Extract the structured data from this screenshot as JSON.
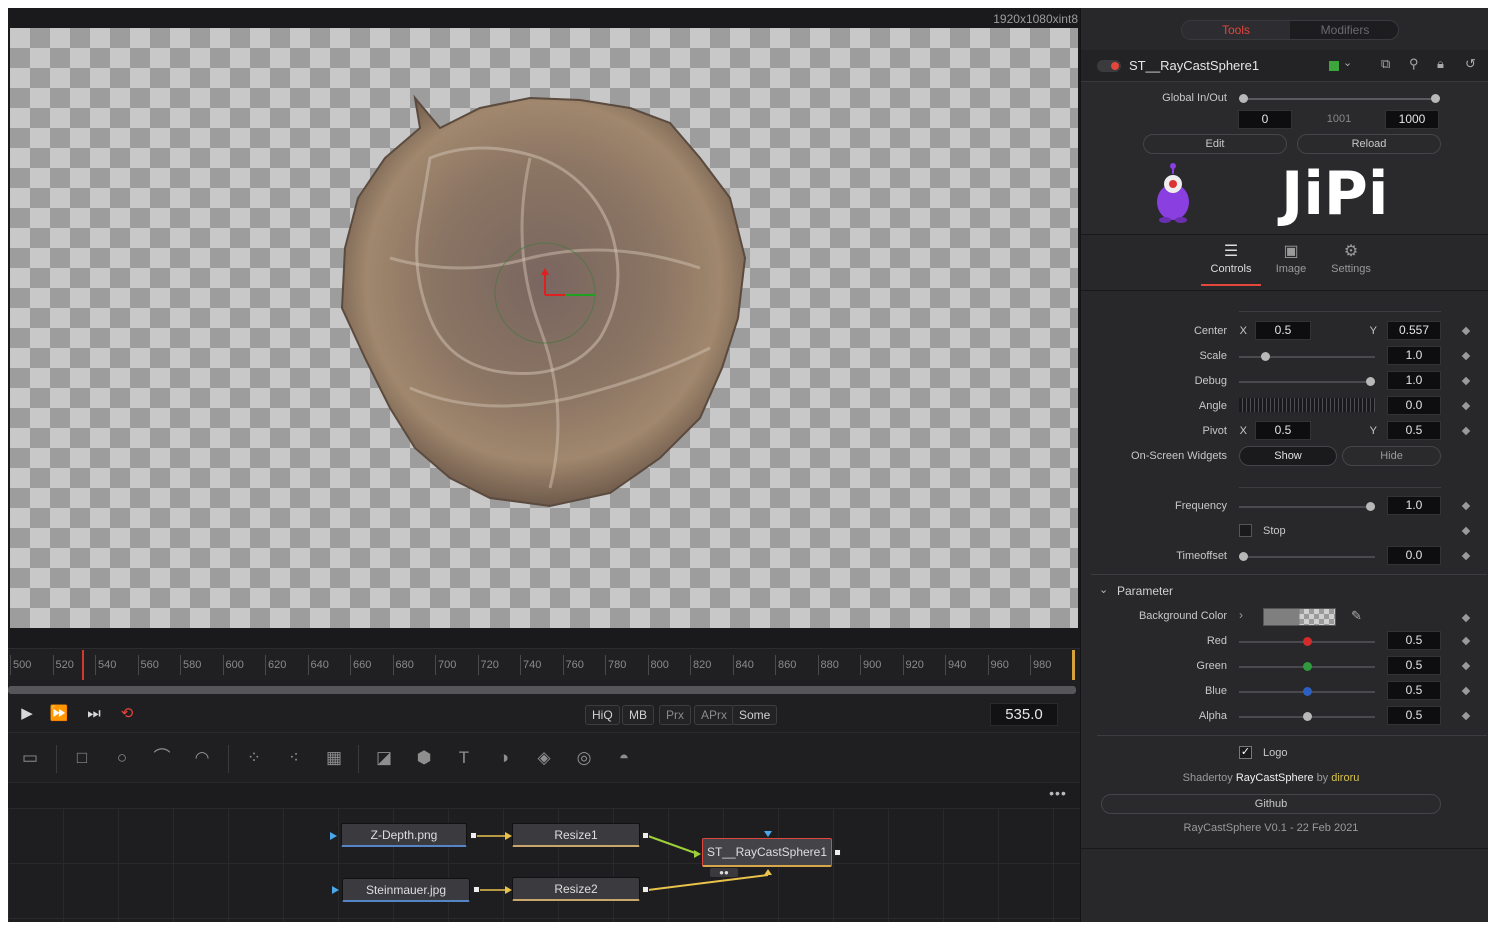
{
  "viewer": {
    "resolution": "1920x1080xint8"
  },
  "ruler": {
    "ticks": [
      "500",
      "520",
      "540",
      "560",
      "580",
      "600",
      "620",
      "640",
      "660",
      "680",
      "700",
      "720",
      "740",
      "760",
      "780",
      "800",
      "820",
      "840",
      "860",
      "880",
      "900",
      "920",
      "940",
      "960",
      "980"
    ]
  },
  "transport": {
    "buttons": [
      "HiQ",
      "MB",
      "Prx",
      "APrx",
      "Some"
    ],
    "current_frame": "535.0"
  },
  "nodes": {
    "zdepth": "Z-Depth.png",
    "stein": "Steinmauer.jpg",
    "resize1": "Resize1",
    "resize2": "Resize2",
    "shader": "ST__RayCastSphere1"
  },
  "inspector": {
    "tabs": {
      "tools": "Tools",
      "modifiers": "Modifiers"
    },
    "tool_name": "ST__RayCastSphere1",
    "global_inout": {
      "label": "Global In/Out",
      "start": "0",
      "mid": "1001",
      "end": "1000"
    },
    "edit": "Edit",
    "reload": "Reload",
    "logo_text": "JiPi",
    "subtabs": {
      "controls": "Controls",
      "image": "Image",
      "settings": "Settings"
    },
    "center": {
      "label": "Center",
      "x_lbl": "X",
      "x": "0.5",
      "y_lbl": "Y",
      "y": "0.557"
    },
    "scale": {
      "label": "Scale",
      "value": "1.0"
    },
    "debug": {
      "label": "Debug",
      "value": "1.0"
    },
    "angle": {
      "label": "Angle",
      "value": "0.0"
    },
    "pivot": {
      "label": "Pivot",
      "x_lbl": "X",
      "x": "0.5",
      "y_lbl": "Y",
      "y": "0.5"
    },
    "osw": {
      "label": "On-Screen Widgets",
      "show": "Show",
      "hide": "Hide"
    },
    "frequency": {
      "label": "Frequency",
      "value": "1.0"
    },
    "stop": {
      "label": "Stop"
    },
    "timeoffset": {
      "label": "Timeoffset",
      "value": "0.0"
    },
    "parameter": {
      "title": "Parameter",
      "bg_color": "Background Color",
      "red": "Red",
      "green": "Green",
      "blue": "Blue",
      "alpha": "Alpha",
      "red_v": "0.5",
      "green_v": "0.5",
      "blue_v": "0.5",
      "alpha_v": "0.5"
    },
    "logo": {
      "label": "Logo"
    },
    "credit": {
      "prefix": "Shadertoy",
      "name": "RayCastSphere",
      "by": "by",
      "author": "diroru"
    },
    "github": "Github",
    "version": "RayCastSphere V0.1 - 22 Feb 2021"
  },
  "colors": {
    "accent": "#e3463b",
    "knob_red": "#d12b2b",
    "knob_green": "#2e9a3b",
    "knob_blue": "#2b5fc0",
    "author": "#d8c24a"
  }
}
